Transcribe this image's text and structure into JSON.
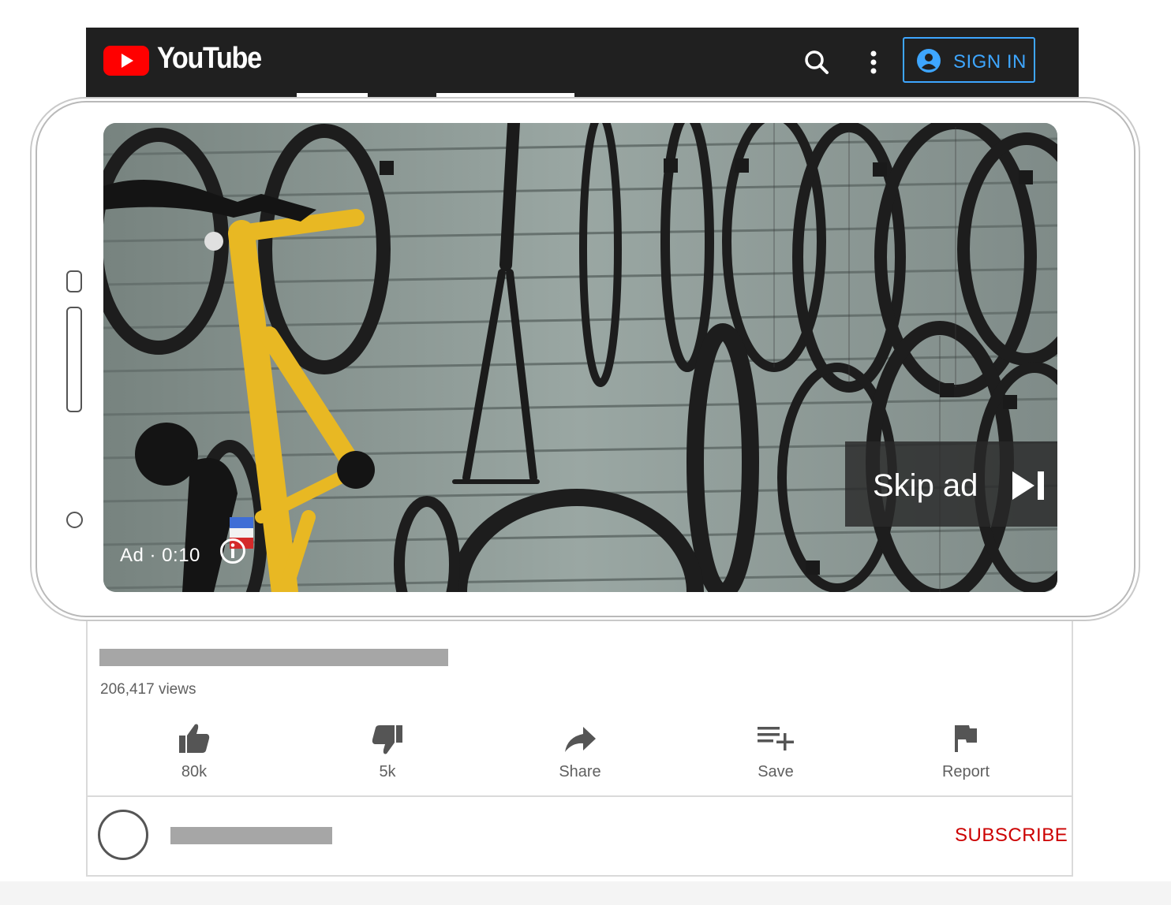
{
  "header": {
    "brand": "YouTube",
    "sign_in_label": "SIGN IN",
    "icons": [
      "youtube-play-icon",
      "search-icon",
      "more-vert-icon",
      "account-circle-icon"
    ]
  },
  "player": {
    "ad_label": "Ad · 0:10",
    "skip_label": "Skip ad",
    "icons": [
      "ad-info-icon",
      "skip-next-icon"
    ]
  },
  "video_info": {
    "views": "206,417 views"
  },
  "actions": [
    {
      "id": "like",
      "label": "80k",
      "icon": "thumb-up-icon"
    },
    {
      "id": "dislike",
      "label": "5k",
      "icon": "thumb-down-icon"
    },
    {
      "id": "share",
      "label": "Share",
      "icon": "share-icon"
    },
    {
      "id": "save",
      "label": "Save",
      "icon": "playlist-add-icon"
    },
    {
      "id": "report",
      "label": "Report",
      "icon": "flag-icon"
    }
  ],
  "channel": {
    "subscribe_label": "SUBSCRIBE"
  },
  "colors": {
    "header_bg": "#202020",
    "brand_red": "#ff0000",
    "link_blue": "#3ea6ff",
    "subscribe_red": "#cc0000",
    "bike_yellow": "#e8b823"
  }
}
